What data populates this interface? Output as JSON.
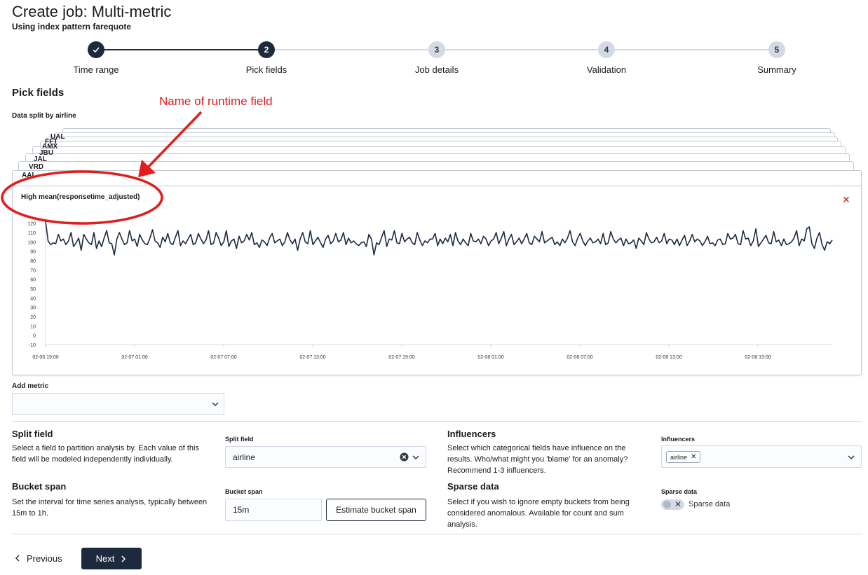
{
  "header": {
    "title": "Create job: Multi-metric",
    "subtitle": "Using index pattern farequote"
  },
  "stepper": {
    "steps": [
      {
        "number": "",
        "label": "Time range",
        "status": "complete"
      },
      {
        "number": "2",
        "label": "Pick fields",
        "status": "current"
      },
      {
        "number": "3",
        "label": "Job details",
        "status": "incomplete"
      },
      {
        "number": "4",
        "label": "Validation",
        "status": "incomplete"
      },
      {
        "number": "5",
        "label": "Summary",
        "status": "incomplete"
      }
    ]
  },
  "section_title": "Pick fields",
  "split_caption": "Data split by airline",
  "annotation": {
    "text": "Name of runtime field",
    "color": "#e11d1d"
  },
  "card_stack_labels": [
    "UAL",
    "FFT",
    "AMX",
    "JBU",
    "JAL",
    "VRD",
    "AAL"
  ],
  "chart": {
    "title": "High mean(responsetime_adjusted)",
    "remove_icon": "close-icon"
  },
  "chart_data": {
    "type": "line",
    "title": "High mean(responsetime_adjusted)",
    "xlabel": "",
    "ylabel": "",
    "ylim": [
      -10,
      125
    ],
    "yticks": [
      "120",
      "110",
      "100",
      "90",
      "80",
      "70",
      "60",
      "50",
      "40",
      "30",
      "20",
      "10",
      "0",
      "-10"
    ],
    "xticks": [
      "02-06 19:00",
      "02-07 01:00",
      "02-07 07:00",
      "02-07 13:00",
      "02-07 19:00",
      "02-08 01:00",
      "02-08 07:00",
      "02-08 13:00",
      "02-08 19:00"
    ],
    "series": [
      {
        "color": "#1d2a3e",
        "values": [
          122,
          101,
          97,
          99,
          98,
          108,
          101,
          103,
          97,
          101,
          110,
          95,
          99,
          104,
          91,
          108,
          103,
          99,
          97,
          110,
          93,
          101,
          95,
          104,
          112,
          99,
          98,
          86,
          103,
          110,
          103,
          97,
          99,
          112,
          101,
          103,
          95,
          108,
          102,
          98,
          97,
          104,
          113,
          101,
          99,
          94,
          105,
          100,
          109,
          99,
          97,
          105,
          112,
          96,
          101,
          98,
          103,
          108,
          97,
          99,
          109,
          103,
          98,
          102,
          112,
          97,
          99,
          110,
          104,
          96,
          100,
          112,
          95,
          101,
          103,
          93,
          106,
          99,
          101,
          108,
          102,
          110,
          97,
          99,
          94,
          102,
          100,
          96,
          104,
          109,
          99,
          101,
          103,
          96,
          100,
          110,
          102,
          98,
          103,
          91,
          103,
          110,
          100,
          98,
          112,
          97,
          101,
          105,
          99,
          94,
          103,
          107,
          98,
          101,
          109,
          100,
          102,
          110,
          97,
          104,
          99,
          101,
          98,
          96,
          99,
          100,
          95,
          108,
          103,
          86,
          99,
          97,
          105,
          112,
          95,
          103,
          102,
          112,
          99,
          98,
          109,
          100,
          103,
          105,
          99,
          97,
          110,
          102,
          96,
          101,
          99,
          103,
          103,
          109,
          96,
          103,
          98,
          104,
          100,
          108,
          96,
          110,
          101,
          97,
          103,
          99,
          96,
          109,
          101,
          100,
          103,
          98,
          106,
          103,
          96,
          101,
          103,
          110,
          98,
          104,
          111,
          96,
          103,
          108,
          97,
          100,
          104,
          98,
          103,
          109,
          99,
          97,
          106,
          103,
          100,
          111,
          99,
          101,
          103,
          105,
          97,
          100,
          96,
          103,
          99,
          104,
          112,
          100,
          96,
          104,
          109,
          101,
          96,
          101,
          104,
          99,
          100,
          103,
          98,
          109,
          97,
          99,
          111,
          103,
          99,
          102,
          104,
          96,
          103,
          98,
          99,
          102,
          93,
          104,
          101,
          97,
          110,
          103,
          99,
          100,
          105,
          99,
          101,
          109,
          98,
          103,
          102,
          97,
          103,
          96,
          102,
          107,
          96,
          101,
          108,
          100,
          103,
          101,
          96,
          100,
          106,
          98,
          99,
          96,
          102,
          103,
          97,
          98,
          109,
          103,
          104,
          108,
          98,
          97,
          112,
          103,
          104,
          96,
          101,
          114,
          95,
          99,
          103,
          107,
          99,
          98,
          111,
          100,
          102,
          96,
          103,
          97,
          98,
          100,
          104,
          112,
          96,
          103,
          101,
          114,
          116,
          98,
          93,
          104,
          110,
          97,
          91,
          100,
          98,
          102
        ]
      }
    ]
  },
  "add_metric": {
    "label": "Add metric",
    "value": ""
  },
  "split_field": {
    "title": "Split field",
    "description": "Select a field to partition analysis by. Each value of this field will be modeled independently individually.",
    "input_label": "Split field",
    "value": "airline"
  },
  "influencers": {
    "title": "Influencers",
    "description": "Select which categorical fields have influence on the results. Who/what might you 'blame' for an anomaly? Recommend 1-3 influencers.",
    "input_label": "Influencers",
    "chips": [
      "airline"
    ]
  },
  "bucket_span": {
    "title": "Bucket span",
    "description": "Set the interval for time series analysis, typically between 15m to 1h.",
    "input_label": "Bucket span",
    "value": "15m",
    "estimate_button": "Estimate bucket span"
  },
  "sparse_data": {
    "title": "Sparse data",
    "description": "Select if you wish to ignore empty buckets from being considered anomalous. Available for count and sum analysis.",
    "input_label": "Sparse data",
    "toggle_label": "Sparse data",
    "enabled": false
  },
  "footer": {
    "previous_label": "Previous",
    "next_label": "Next"
  }
}
